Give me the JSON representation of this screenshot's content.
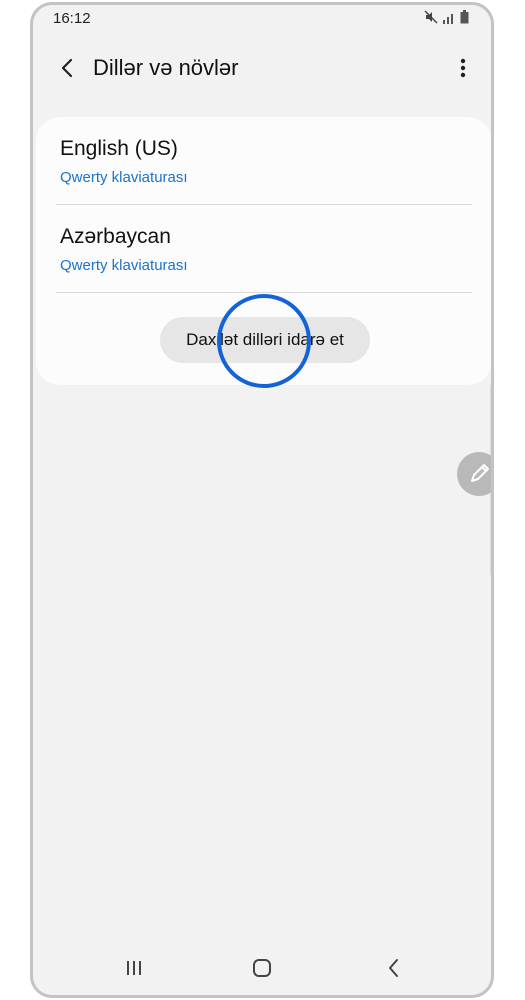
{
  "status_bar": {
    "time": "16:12",
    "icons": [
      "mute-icon",
      "signal-icon",
      "battery-icon"
    ]
  },
  "header": {
    "title": "Dillər və növlər",
    "back_icon": "chevron-left-icon",
    "more_icon": "more-vertical-icon"
  },
  "languages": [
    {
      "name": "English (US)",
      "keyboard": "Qwerty klaviaturası"
    },
    {
      "name": "Azərbaycan",
      "keyboard": "Qwerty klaviaturası"
    }
  ],
  "manage_button": {
    "label": "Daxilət dilləri idarə et"
  },
  "fab": {
    "icon": "pencil-icon"
  },
  "nav_bar": {
    "recent_icon": "recent-apps-icon",
    "home_icon": "home-icon",
    "back_icon": "back-icon"
  },
  "colors": {
    "accent": "#1a73c8",
    "highlight_ring": "#1463d6",
    "background": "#f2f2f2",
    "card": "#fcfcfc"
  }
}
